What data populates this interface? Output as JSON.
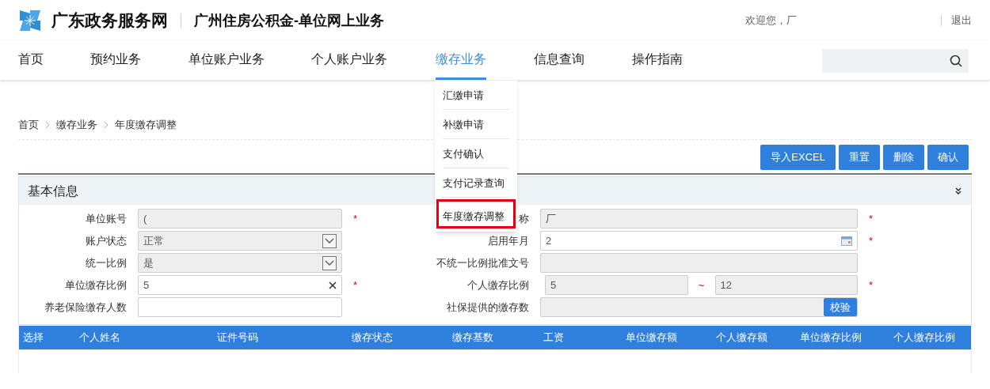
{
  "header": {
    "site_name": "广东政务服务网",
    "system_title": "广州住房公积金-单位网上业务",
    "welcome": "欢迎您，厂",
    "logout": "退出"
  },
  "nav": [
    {
      "label": "首页",
      "selected": false
    },
    {
      "label": "预约业务",
      "selected": false
    },
    {
      "label": "单位账户业务",
      "selected": false
    },
    {
      "label": "个人账户业务",
      "selected": false
    },
    {
      "label": "缴存业务",
      "selected": true
    },
    {
      "label": "信息查询",
      "selected": false
    },
    {
      "label": "操作指南",
      "selected": false
    }
  ],
  "dropdown": [
    {
      "label": "汇缴申请",
      "selected": false
    },
    {
      "label": "补缴申请",
      "selected": false
    },
    {
      "label": "支付确认",
      "selected": false
    },
    {
      "label": "支付记录查询",
      "selected": false
    },
    {
      "label": "年度缴存调整",
      "selected": true
    }
  ],
  "breadcrumb": [
    "首页",
    "缴存业务",
    "年度缴存调整"
  ],
  "buttons": [
    "导入EXCEL",
    "重置",
    "删除",
    "确认"
  ],
  "panel": {
    "title": "基本信息",
    "rows": [
      {
        "left": {
          "label": "单位账号",
          "kind": "text",
          "value": "(",
          "disabled": true,
          "required_mark": "*"
        },
        "right": {
          "label": "称",
          "kind": "text",
          "value": "厂",
          "disabled": true,
          "required_mark": "*"
        }
      },
      {
        "left": {
          "label": "账户状态",
          "kind": "select",
          "value": "正常",
          "disabled": true
        },
        "right": {
          "label": "启用年月",
          "kind": "date",
          "value": "2",
          "disabled": false,
          "required_mark": "*"
        }
      },
      {
        "left": {
          "label": "统一比例",
          "kind": "select",
          "value": "是",
          "disabled": true
        },
        "right": {
          "label": "不统一比例批准文号",
          "kind": "text",
          "disabled": true
        }
      },
      {
        "left": {
          "label": "单位缴存比例",
          "kind": "clearable",
          "value": "5",
          "disabled": false,
          "required_mark": "*"
        },
        "right": {
          "label": "个人缴存比例",
          "kind": "range",
          "value": "5",
          "separator": "~",
          "value2": "12",
          "disabled": true,
          "required_mark": "*"
        }
      },
      {
        "left": {
          "label": "养老保险缴存人数",
          "kind": "text",
          "disabled": false
        },
        "right": {
          "label": "社保提供的缴存数",
          "kind": "button",
          "button": "校验",
          "disabled": true
        }
      }
    ]
  },
  "table": {
    "columns": [
      "选择",
      "个人姓名",
      "证件号码",
      "缴存状态",
      "缴存基数",
      "工资",
      "单位缴存额",
      "个人缴存额",
      "单位缴存比例",
      "个人缴存比例"
    ]
  }
}
